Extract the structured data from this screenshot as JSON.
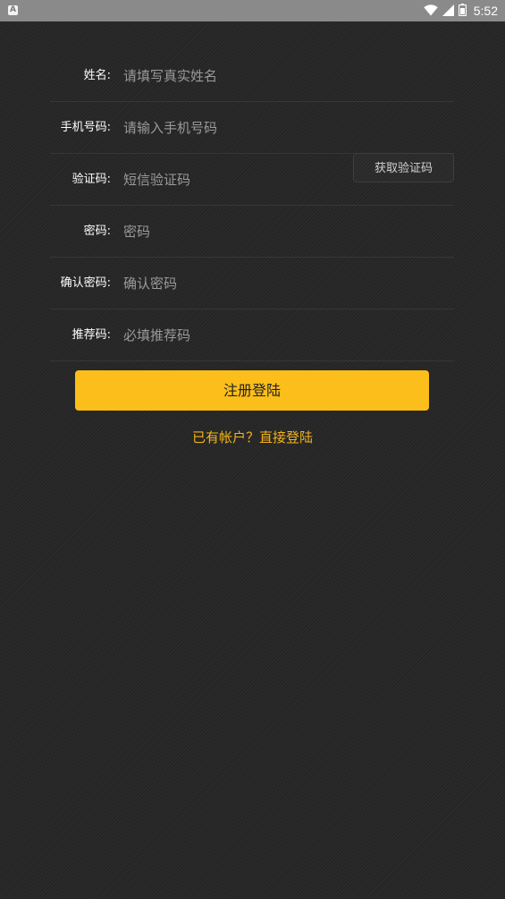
{
  "status_bar": {
    "left_icon": "A",
    "wifi_icon": "wifi-icon",
    "signal_icon": "signal-icon",
    "battery_icon": "battery-icon",
    "time": "5:52"
  },
  "form": {
    "name_label": "姓名:",
    "name_placeholder": "请填写真实姓名",
    "phone_label": "手机号码:",
    "phone_placeholder": "请输入手机号码",
    "code_label": "验证码:",
    "code_placeholder": "短信验证码",
    "get_code_button": "获取验证码",
    "password_label": "密码:",
    "password_placeholder": "密码",
    "confirm_label": "确认密码:",
    "confirm_placeholder": "确认密码",
    "referral_label": "推荐码:",
    "referral_placeholder": "必填推荐码"
  },
  "actions": {
    "register_button": "注册登陆",
    "login_link": "已有帐户？直接登陆"
  },
  "colors": {
    "accent": "#fbbe1b",
    "link": "#f2b31c",
    "background": "#252525",
    "status_bar": "#8a8a8a"
  }
}
